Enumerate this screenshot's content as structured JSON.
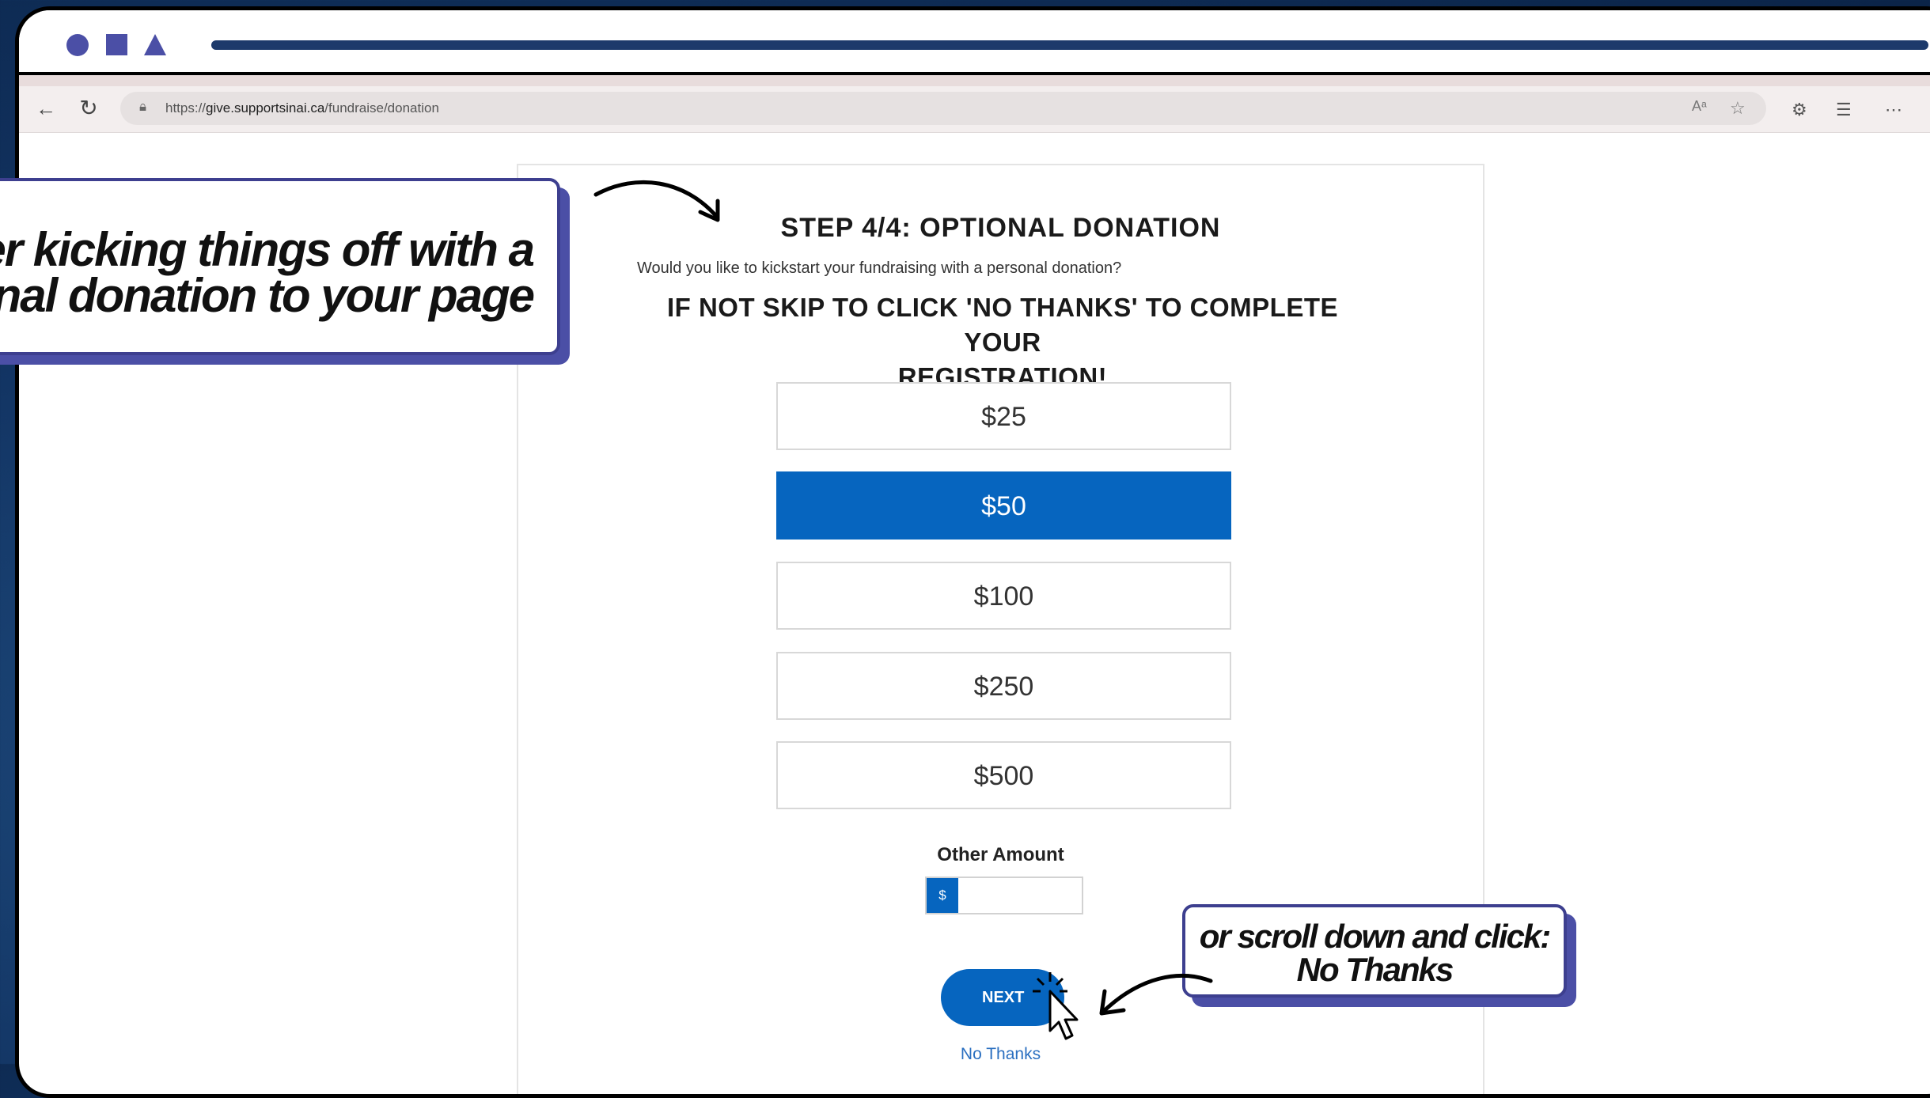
{
  "browser": {
    "url_prefix": "https://",
    "url_host": "give.supportsinai.ca",
    "url_path": "/fundraise/donation"
  },
  "form": {
    "title": "STEP 4/4: OPTIONAL DONATION",
    "subtitle": "Would you like to kickstart your fundraising with a personal donation?",
    "skip_line1": "IF NOT SKIP TO CLICK 'NO THANKS' TO COMPLETE YOUR",
    "skip_line2": "REGISTRATION!",
    "amounts": [
      {
        "label": "$25",
        "selected": false
      },
      {
        "label": "$50",
        "selected": true
      },
      {
        "label": "$100",
        "selected": false
      },
      {
        "label": "$250",
        "selected": false
      },
      {
        "label": "$500",
        "selected": false
      }
    ],
    "other_amount_label": "Other Amount",
    "currency_symbol": "$",
    "other_amount_value": "",
    "next_label": "NEXT",
    "no_thanks_label": "No Thanks"
  },
  "callouts": {
    "left_line1": "ider kicking things off with a",
    "left_line2": "sonal donation to your page",
    "right_line1": "or scroll down and click:",
    "right_line2": "No Thanks"
  },
  "icons": {
    "back": "arrow-left-icon",
    "refresh": "refresh-icon",
    "lock": "lock-icon",
    "read_aloud": "read-aloud-icon",
    "favorite": "star-icon",
    "extensions": "puzzle-icon",
    "favorites_bar": "favorites-list-icon",
    "more": "ellipsis-icon",
    "cursor": "pointer-cursor-icon"
  },
  "colors": {
    "accent_blue": "#0665bf",
    "callout_border": "#3d3f8f",
    "background_navy": "#123463"
  }
}
